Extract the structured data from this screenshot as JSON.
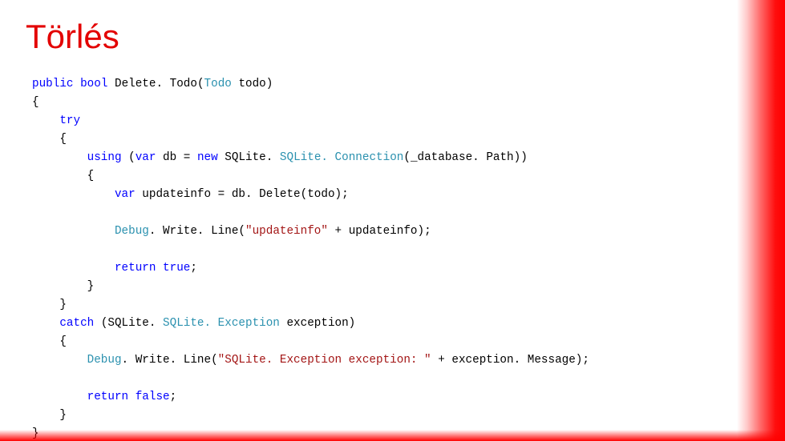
{
  "title": "Törlés",
  "code": {
    "l01a": "public",
    "l01b": "bool",
    "l01c": " Delete. Todo(",
    "l01d": "Todo",
    "l01e": " todo)",
    "l02": "{",
    "l03a": "    ",
    "l03b": "try",
    "l04": "    {",
    "l05a": "        ",
    "l05b": "using",
    "l05c": " (",
    "l05d": "var",
    "l05e": " db = ",
    "l05f": "new",
    "l05g": " SQLite. ",
    "l05h": "SQLite. Connection",
    "l05i": "(_database. Path))",
    "l06": "        {",
    "l07a": "            ",
    "l07b": "var",
    "l07c": " updateinfo = db. Delete(todo);",
    "l08": "",
    "l09a": "            ",
    "l09b": "Debug",
    "l09c": ". Write. Line(",
    "l09d": "\"updateinfo\"",
    "l09e": " + updateinfo);",
    "l10": "",
    "l11a": "            ",
    "l11b": "return",
    "l11c": " ",
    "l11d": "true",
    "l11e": ";",
    "l12": "        }",
    "l13": "    }",
    "l14a": "    ",
    "l14b": "catch",
    "l14c": " (SQLite. ",
    "l14d": "SQLite. Exception",
    "l14e": " exception)",
    "l15": "    {",
    "l16a": "        ",
    "l16b": "Debug",
    "l16c": ". Write. Line(",
    "l16d": "\"SQLite. Exception exception: \"",
    "l16e": " + exception. Message);",
    "l17": "",
    "l18a": "        ",
    "l18b": "return",
    "l18c": " ",
    "l18d": "false",
    "l18e": ";",
    "l19": "    }",
    "l20": "}"
  }
}
